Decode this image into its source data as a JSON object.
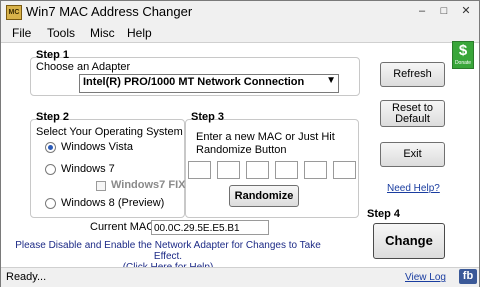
{
  "window": {
    "title": "Win7 MAC Address Changer",
    "app_icon": "mac-changer-icon",
    "minimize_glyph": "–",
    "maximize_glyph": "□",
    "close_glyph": "✕"
  },
  "menu": [
    "File",
    "Tools",
    "Misc",
    "Help"
  ],
  "step1": {
    "heading": "Step 1",
    "label": "Choose an Adapter",
    "adapter_selected": "Intel(R) PRO/1000 MT Network Connection",
    "dropdown_arrow": "▼"
  },
  "step2": {
    "heading": "Step 2",
    "label": "Select Your Operating System",
    "options": [
      "Windows Vista",
      "Windows 7",
      "Windows 8 (Preview)"
    ],
    "selected": "Windows Vista",
    "windows7_fix_label": "Windows7 FIX"
  },
  "step3": {
    "heading": "Step 3",
    "instruction_line1": "Enter a new MAC or Just Hit",
    "instruction_line2": "Randomize Button",
    "mac_fields": [
      "",
      "",
      "",
      "",
      "",
      ""
    ],
    "randomize_label": "Randomize"
  },
  "right_buttons": {
    "refresh": "Refresh",
    "reset_line1": "Reset to",
    "reset_line2": "Default",
    "exit": "Exit",
    "need_help": "Need Help?"
  },
  "step4": {
    "heading": "Step 4",
    "change_label": "Change"
  },
  "current_mac": {
    "label": "Current MAC",
    "value": "00.0C.29.5E.E5.B1"
  },
  "note": {
    "line1": "Please Disable and Enable the Network Adapter for Changes to Take Effect.",
    "line2": "(Click Here for Help)"
  },
  "status": {
    "text": "Ready...",
    "view_log": "View Log",
    "fb": "fb"
  },
  "badge": {
    "symbol": "$",
    "text": "Donate"
  },
  "colors": {
    "link": "#1a3da0",
    "note": "#1c2a86",
    "badge": "#39a63a",
    "fb": "#3b5998"
  }
}
